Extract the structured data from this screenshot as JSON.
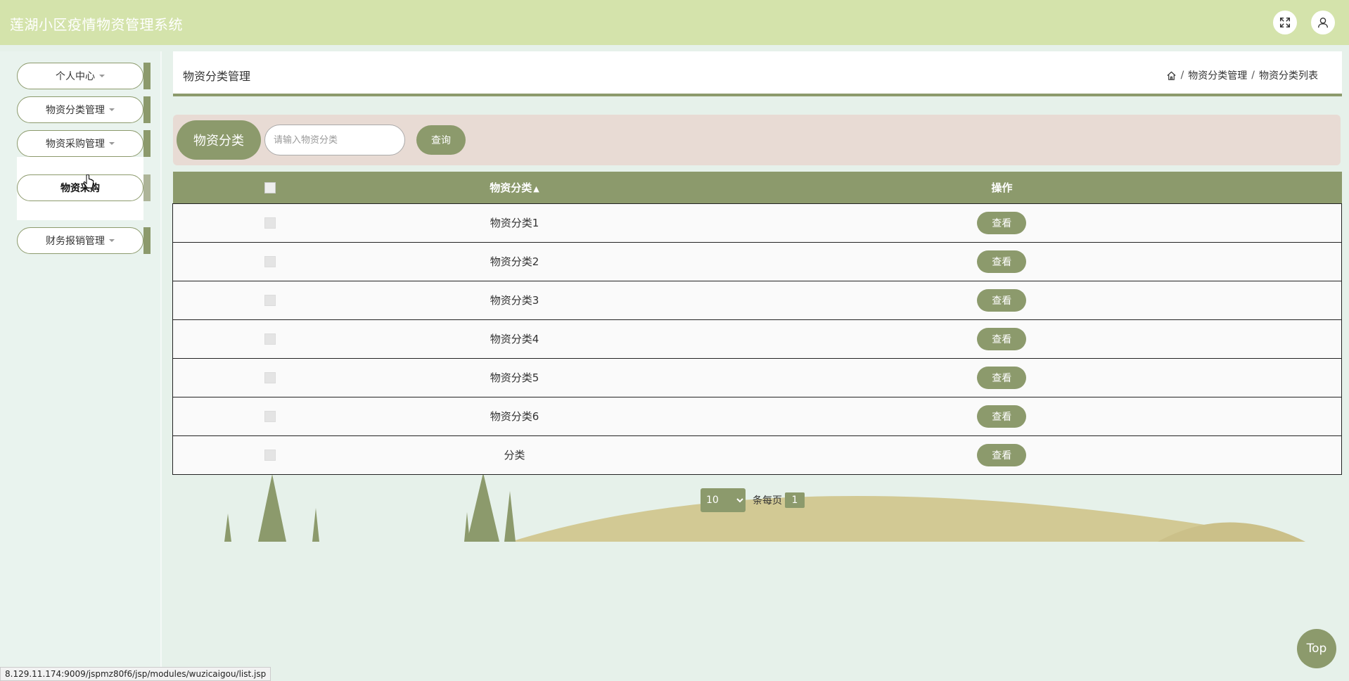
{
  "app": {
    "title": "莲湖小区疫情物资管理系统"
  },
  "header": {
    "fullscreen_icon": "expand-icon",
    "user_icon": "user-icon"
  },
  "sidebar": {
    "items": [
      {
        "label": "个人中心"
      },
      {
        "label": "物资分类管理"
      },
      {
        "label": "物资采购管理"
      },
      {
        "label": "财务报销管理"
      }
    ],
    "submenu": {
      "label": "物资采购"
    }
  },
  "main": {
    "page_title": "物资分类管理",
    "breadcrumb": {
      "home_icon": "home-icon",
      "items": [
        "物资分类管理",
        "物资分类列表"
      ]
    }
  },
  "search": {
    "label": "物资分类",
    "placeholder": "请输入物资分类",
    "value": "",
    "button": "查询"
  },
  "table": {
    "columns": [
      "",
      "物资分类",
      "操作"
    ],
    "sort_icon": "sort-icon",
    "rows": [
      {
        "category": "物资分类1",
        "action": "查看"
      },
      {
        "category": "物资分类2",
        "action": "查看"
      },
      {
        "category": "物资分类3",
        "action": "查看"
      },
      {
        "category": "物资分类4",
        "action": "查看"
      },
      {
        "category": "物资分类5",
        "action": "查看"
      },
      {
        "category": "物资分类6",
        "action": "查看"
      },
      {
        "category": "分类",
        "action": "查看"
      }
    ]
  },
  "pagination": {
    "page_size": "10",
    "per_page_label": "条每页",
    "current_page": "1"
  },
  "status_url": "8.129.11.174:9009/jspmz80f6/jsp/modules/wuzicaigou/list.jsp",
  "top_button": "Top",
  "colors": {
    "accent": "#8c9a6c",
    "header": "#d4e3ab",
    "background": "#e6f1ea",
    "search_bg": "#e8dbd4"
  }
}
